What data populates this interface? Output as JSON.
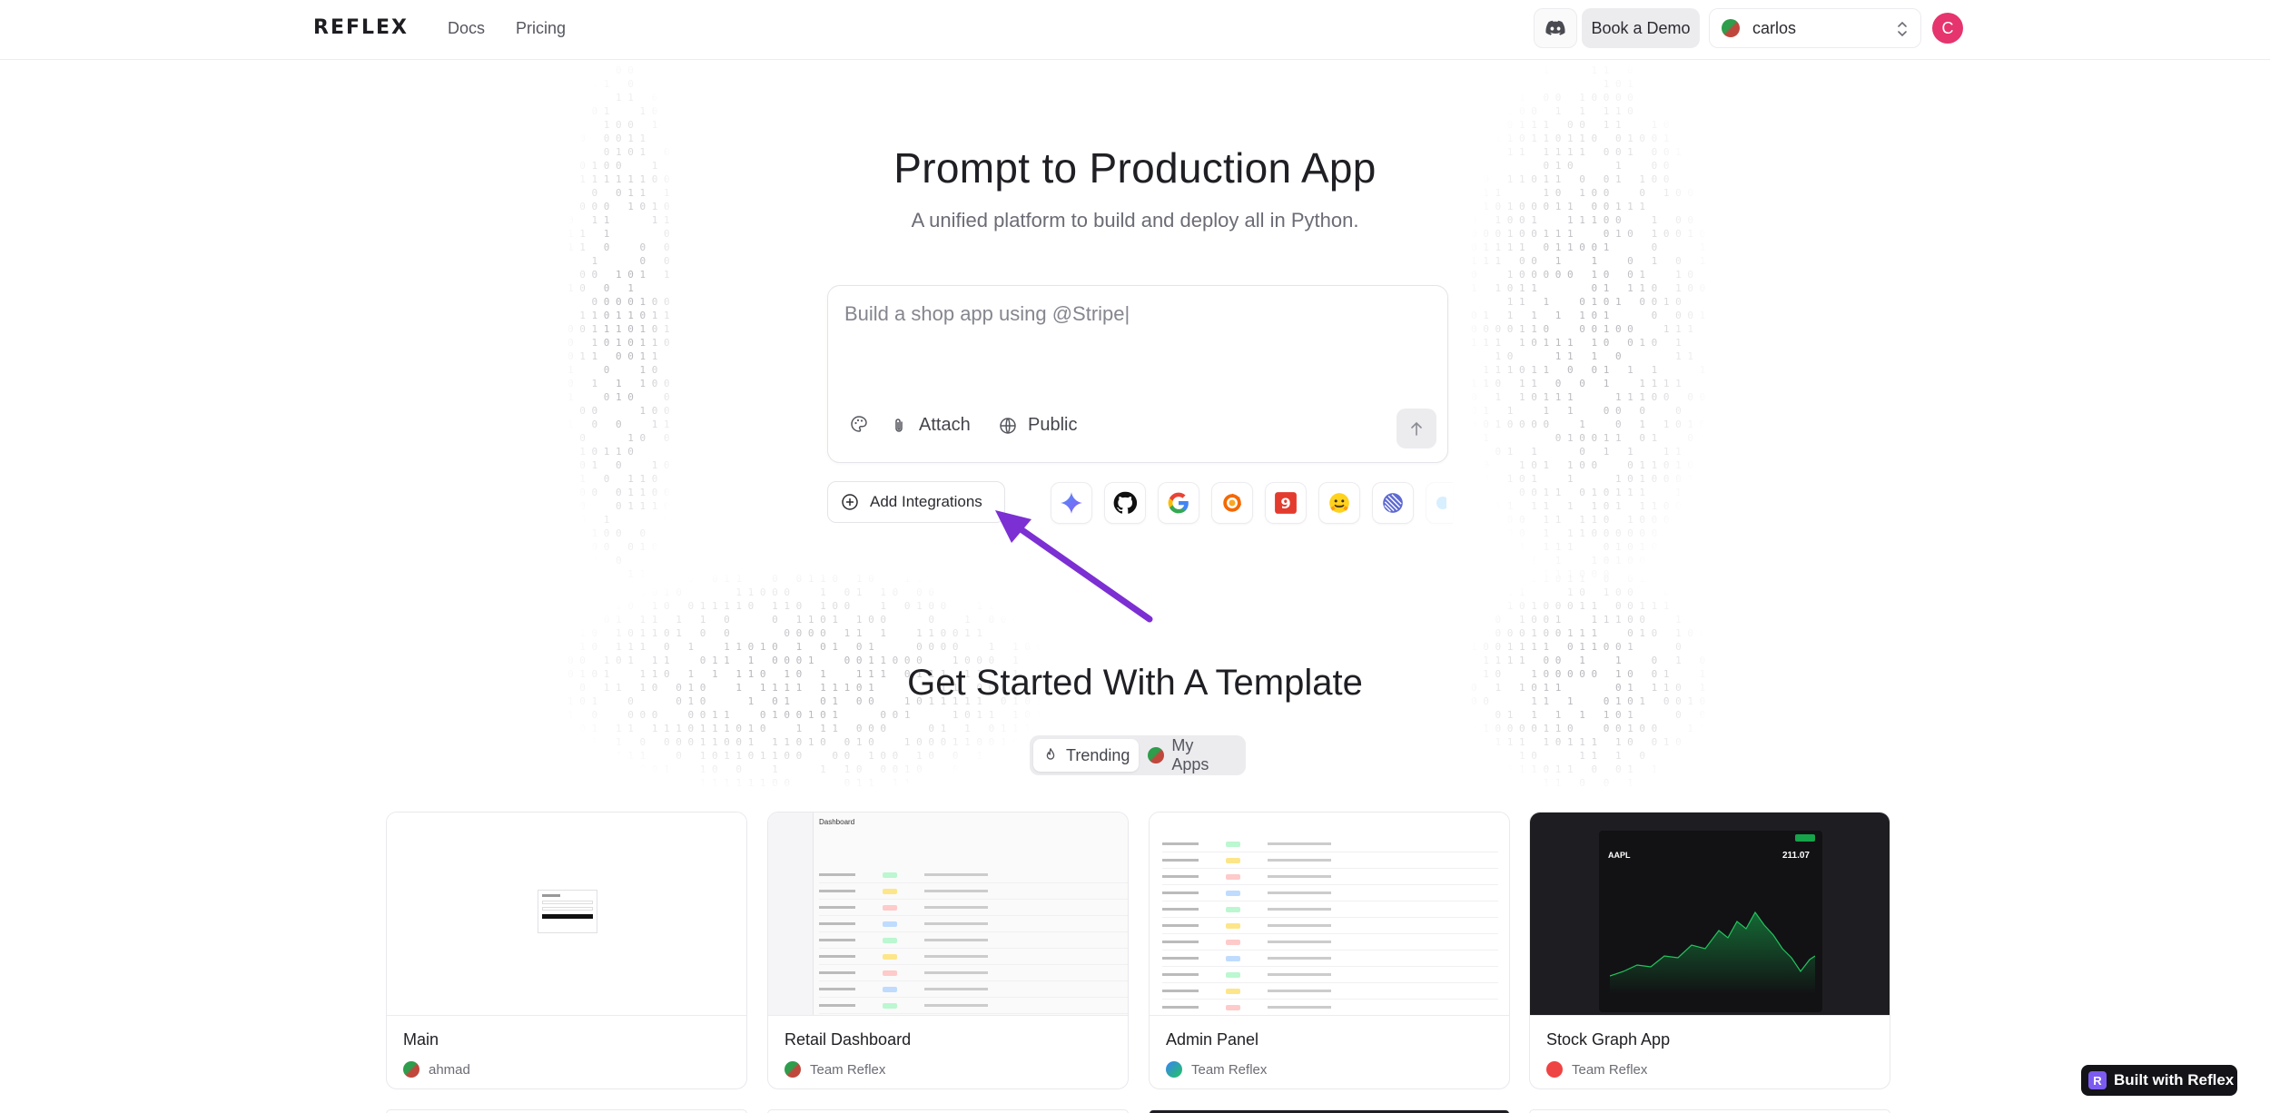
{
  "header": {
    "logo": "REFLEX",
    "nav": [
      {
        "label": "Docs"
      },
      {
        "label": "Pricing"
      }
    ],
    "discord_icon": "discord-icon",
    "book_demo": "Book a Demo",
    "account": {
      "name": "carlos",
      "icon": "chevron-up-down-icon"
    },
    "avatar_initial": "C"
  },
  "hero": {
    "title": "Prompt to Production App",
    "subtitle": "A unified platform to build and deploy all in Python."
  },
  "prompt": {
    "value": "Build a shop app using @Stripe|",
    "attach_label": "Attach",
    "visibility_label": "Public",
    "tools_icons": [
      "palette-icon",
      "paperclip-icon",
      "globe-icon",
      "arrow-up-icon"
    ]
  },
  "integrations": {
    "add_label": "Add Integrations",
    "icons": [
      "gemini-icon",
      "github-icon",
      "google-icon",
      "grafana-icon",
      "9-icon",
      "huggingface-icon",
      "linear-icon",
      "more-icon"
    ]
  },
  "templates": {
    "title": "Get Started With A Template",
    "tabs": [
      {
        "label": "Trending",
        "icon": "flame-icon"
      },
      {
        "label": "My Apps",
        "icon": "team-dot"
      }
    ],
    "cards": [
      {
        "title": "Main",
        "author": "ahmad"
      },
      {
        "title": "Retail Dashboard",
        "author": "Team Reflex",
        "preview_heading": "Dashboard"
      },
      {
        "title": "Admin Panel",
        "author": "Team Reflex"
      },
      {
        "title": "Stock Graph App",
        "author": "Team Reflex",
        "preview_ticker": "AAPL",
        "preview_price": "211.07"
      }
    ]
  },
  "colors": {
    "accent_purple": "#7c2fd3",
    "avatar": "#e5346e",
    "dark": "#131318"
  },
  "badge": {
    "label": "Built with Reflex",
    "logo": "R"
  }
}
